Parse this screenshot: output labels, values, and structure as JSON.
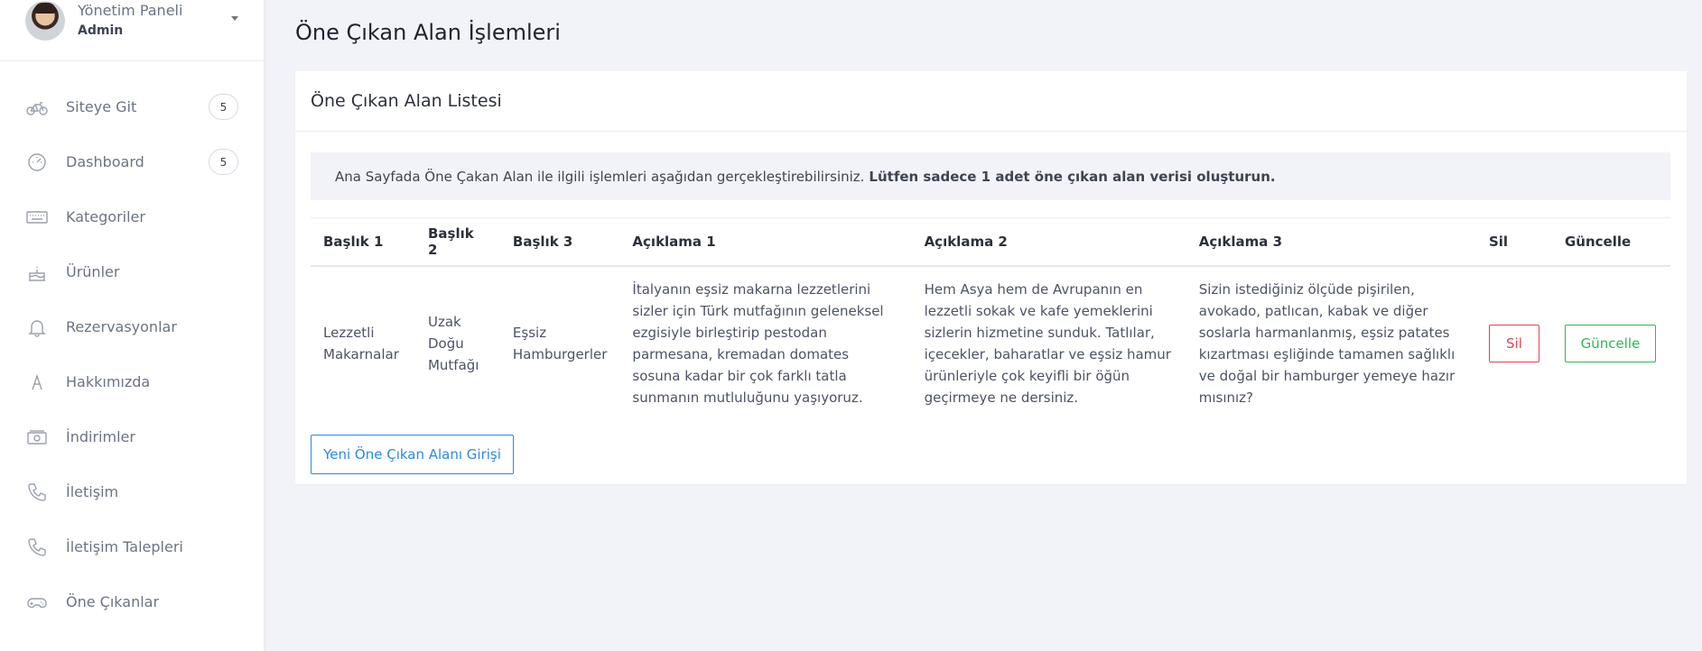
{
  "profile": {
    "name": "Yönetim Paneli",
    "role": "Admin"
  },
  "sidebar": {
    "items": [
      {
        "label": "Siteye Git",
        "icon": "bicycle-icon",
        "badge": "5"
      },
      {
        "label": "Dashboard",
        "icon": "gauge-icon",
        "badge": "5"
      },
      {
        "label": "Kategoriler",
        "icon": "keyboard-icon"
      },
      {
        "label": "Ürünler",
        "icon": "cake-icon"
      },
      {
        "label": "Rezervasyonlar",
        "icon": "bell-icon"
      },
      {
        "label": "Hakkımızda",
        "icon": "text-a-icon"
      },
      {
        "label": "İndirimler",
        "icon": "money-icon"
      },
      {
        "label": "İletişim",
        "icon": "phone-icon"
      },
      {
        "label": "İletişim Talepleri",
        "icon": "phone-icon"
      },
      {
        "label": "Öne Çıkanlar",
        "icon": "gamepad-icon"
      }
    ]
  },
  "main": {
    "title": "Öne Çıkan Alan İşlemleri",
    "card_title": "Öne Çıkan Alan Listesi",
    "alert_text": "Ana Sayfada Öne Çakan Alan ile ilgili işlemleri aşağıdan gerçekleştirebilirsiniz.",
    "alert_bold": "Lütfen sadece 1 adet öne çıkan alan verisi oluşturun.",
    "columns": [
      "Başlık 1",
      "Başlık 2",
      "Başlık 3",
      "Açıklama 1",
      "Açıklama 2",
      "Açıklama 3",
      "Sil",
      "Güncelle"
    ],
    "rows": [
      {
        "baslik1": "Lezzetli Makarnalar",
        "baslik2": "Uzak Doğu Mutfağı",
        "baslik3": "Eşsiz Hamburgerler",
        "aciklama1": "İtalyanın eşsiz makarna lezzetlerini sizler için Türk mutfağının geleneksel ezgisiyle birleştirip pestodan parmesana, kremadan domates sosuna kadar bir çok farklı tatla sunmanın mutluluğunu yaşıyoruz.",
        "aciklama2": "Hem Asya hem de Avrupanın en lezzetli sokak ve kafe yemeklerini sizlerin hizmetine sunduk. Tatlılar, içecekler, baharatlar ve eşsiz hamur ürünleriyle çok keyifli bir öğün geçirmeye ne dersiniz.",
        "aciklama3": "Sizin istediğiniz ölçüde pişirilen, avokado, patlıcan, kabak ve diğer soslarla harmanlanmış, eşsiz patates kızartması eşliğinde tamamen sağlıklı ve doğal bir hamburger yemeye hazır mısınız?",
        "sil_label": "Sil",
        "guncelle_label": "Güncelle"
      }
    ],
    "new_button_label": "Yeni Öne Çıkan Alanı Girişi"
  },
  "colors": {
    "danger": "#e4434f",
    "success": "#2fb650",
    "primary": "#2a8ae8"
  }
}
